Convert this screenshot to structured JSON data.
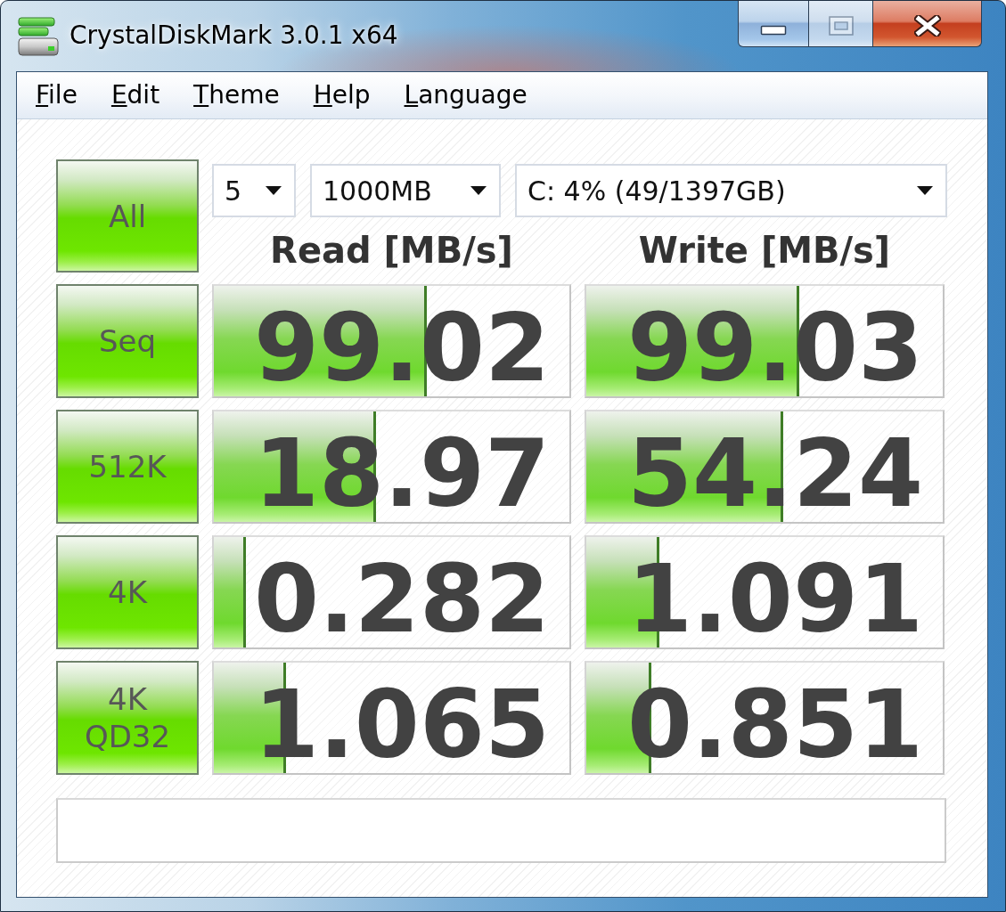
{
  "window": {
    "title": "CrystalDiskMark 3.0.1 x64",
    "caption_buttons": [
      {
        "kind": "minimize",
        "disabled": false
      },
      {
        "kind": "maximize",
        "disabled": true
      },
      {
        "kind": "close",
        "disabled": false
      }
    ]
  },
  "menu": [
    "File",
    "Edit",
    "Theme",
    "Help",
    "Language"
  ],
  "all_button": "All",
  "settings": [
    "5",
    "1000MB",
    "C: 4% (49/1397GB)"
  ],
  "columns": [
    "Read [MB/s]",
    "Write [MB/s]"
  ],
  "tests": [
    {
      "label": "Seq",
      "read": {
        "value": "99.02",
        "level": 0.598
      },
      "write": {
        "value": "99.03",
        "level": 0.597
      }
    },
    {
      "label": "512K",
      "read": {
        "value": "18.97",
        "level": 0.457
      },
      "write": {
        "value": "54.24",
        "level": 0.552
      }
    },
    {
      "label": "4K",
      "read": {
        "value": "0.282",
        "level": 0.09
      },
      "write": {
        "value": "1.091",
        "level": 0.205
      }
    },
    {
      "label": "4K QD32",
      "read": {
        "value": "1.065",
        "level": 0.203
      },
      "write": {
        "value": "0.851",
        "level": 0.183
      }
    }
  ]
}
